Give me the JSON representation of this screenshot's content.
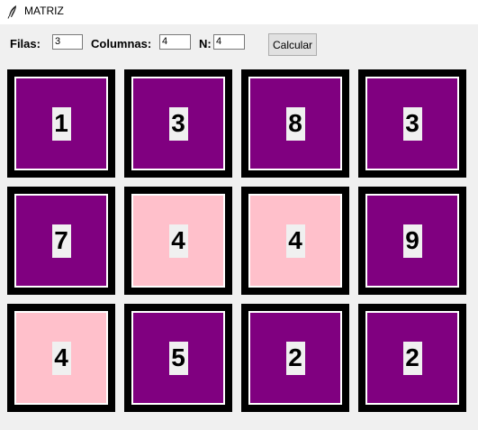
{
  "window": {
    "title": "MATRIZ",
    "icon": "feather-icon"
  },
  "form": {
    "filas_label": "Filas:",
    "filas_value": "3",
    "columnas_label": "Columnas:",
    "columnas_value": "4",
    "n_label": "N:",
    "n_value": "4",
    "calcular_label": "Calcular"
  },
  "colors": {
    "highlight": "#ffc0cb",
    "normal": "#800080",
    "frame": "#000000"
  },
  "matrix": [
    [
      {
        "value": "1",
        "state": "normal"
      },
      {
        "value": "3",
        "state": "normal"
      },
      {
        "value": "8",
        "state": "normal"
      },
      {
        "value": "3",
        "state": "normal"
      }
    ],
    [
      {
        "value": "7",
        "state": "normal"
      },
      {
        "value": "4",
        "state": "highlight"
      },
      {
        "value": "4",
        "state": "highlight"
      },
      {
        "value": "9",
        "state": "normal"
      }
    ],
    [
      {
        "value": "4",
        "state": "highlight"
      },
      {
        "value": "5",
        "state": "normal"
      },
      {
        "value": "2",
        "state": "normal"
      },
      {
        "value": "2",
        "state": "normal"
      }
    ]
  ]
}
